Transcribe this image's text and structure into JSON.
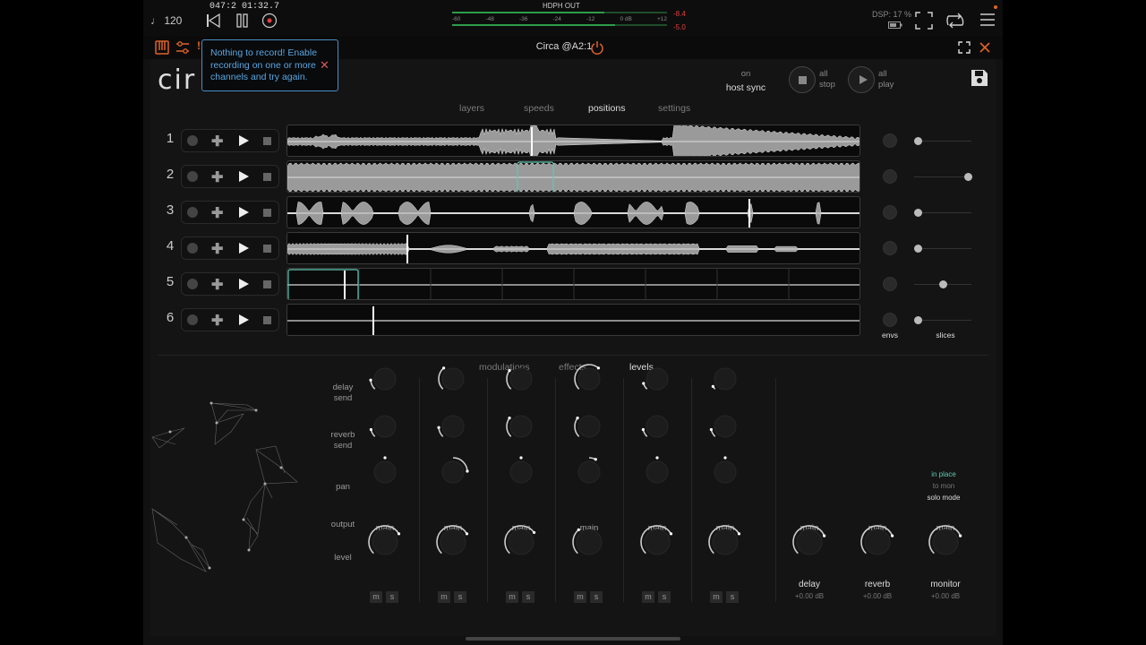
{
  "topbar": {
    "tempo": "♩ 120",
    "position_bars": "047:2",
    "position_time": "01:32.7",
    "meter_title": "HDPH OUT",
    "meter_scale": [
      "-60",
      "-48",
      "-36",
      "-24",
      "-12",
      "0 dB",
      "+12"
    ],
    "peak_top": "-8.4",
    "peak_bottom": "-5.0",
    "dsp": "DSP: 17 %"
  },
  "header": {
    "plugin_title": "Circa @A2:1"
  },
  "tooltip": {
    "message": "Nothing to record! Enable recording on one or more channels and try again."
  },
  "plugin": {
    "logo": "cir",
    "sync_state": "on",
    "sync_label": "host sync",
    "all_stop": "all\nstop",
    "all_play": "all\nplay"
  },
  "tabs_top": [
    {
      "label": "layers",
      "active": false
    },
    {
      "label": "speeds",
      "active": false
    },
    {
      "label": "positions",
      "active": true
    },
    {
      "label": "settings",
      "active": false
    }
  ],
  "rows": [
    {
      "num": "1",
      "slider": 0.0
    },
    {
      "num": "2",
      "slider": 1.0
    },
    {
      "num": "3",
      "slider": 0.0
    },
    {
      "num": "4",
      "slider": 0.0
    },
    {
      "num": "5",
      "slider": 0.5
    },
    {
      "num": "6",
      "slider": 0.0
    }
  ],
  "row_footer": {
    "envs": "envs",
    "slices": "slices"
  },
  "tabs_bottom": [
    {
      "label": "modulations",
      "active": false
    },
    {
      "label": "effects",
      "active": false
    },
    {
      "label": "levels",
      "active": true
    }
  ],
  "mixer": {
    "row_labels": [
      "delay\nsend",
      "reverb\nsend",
      "pan",
      "output",
      "level"
    ],
    "output": "main",
    "mute": "m",
    "solo": "s",
    "channels": [
      {
        "delay": 0.15,
        "reverb": 0.12,
        "pan": 0.5,
        "level": 0.72
      },
      {
        "delay": 0.35,
        "reverb": 0.15,
        "pan": 0.82,
        "level": 0.72
      },
      {
        "delay": 0.3,
        "reverb": 0.3,
        "pan": 0.5,
        "level": 0.7
      },
      {
        "delay": 0.65,
        "reverb": 0.3,
        "pan": 0.6,
        "level": 0.35
      },
      {
        "delay": 0.1,
        "reverb": 0.12,
        "pan": 0.5,
        "level": 0.72
      },
      {
        "delay": 0.05,
        "reverb": 0.12,
        "pan": 0.5,
        "level": 0.72
      }
    ],
    "buses": [
      {
        "name": "delay",
        "gain": "+0.00 dB",
        "level": 0.75
      },
      {
        "name": "reverb",
        "gain": "+0.00 dB",
        "level": 0.75
      },
      {
        "name": "monitor",
        "gain": "+0.00 dB",
        "level": 0.75
      }
    ],
    "solo_options": [
      "in place",
      "to mon"
    ],
    "solo_label": "solo mode"
  },
  "colors": {
    "accent_teal": "#5fc9b4",
    "tooltip_blue": "#5aa6e0",
    "record_red": "#e04040",
    "toolbar_orange": "#e0632a"
  }
}
